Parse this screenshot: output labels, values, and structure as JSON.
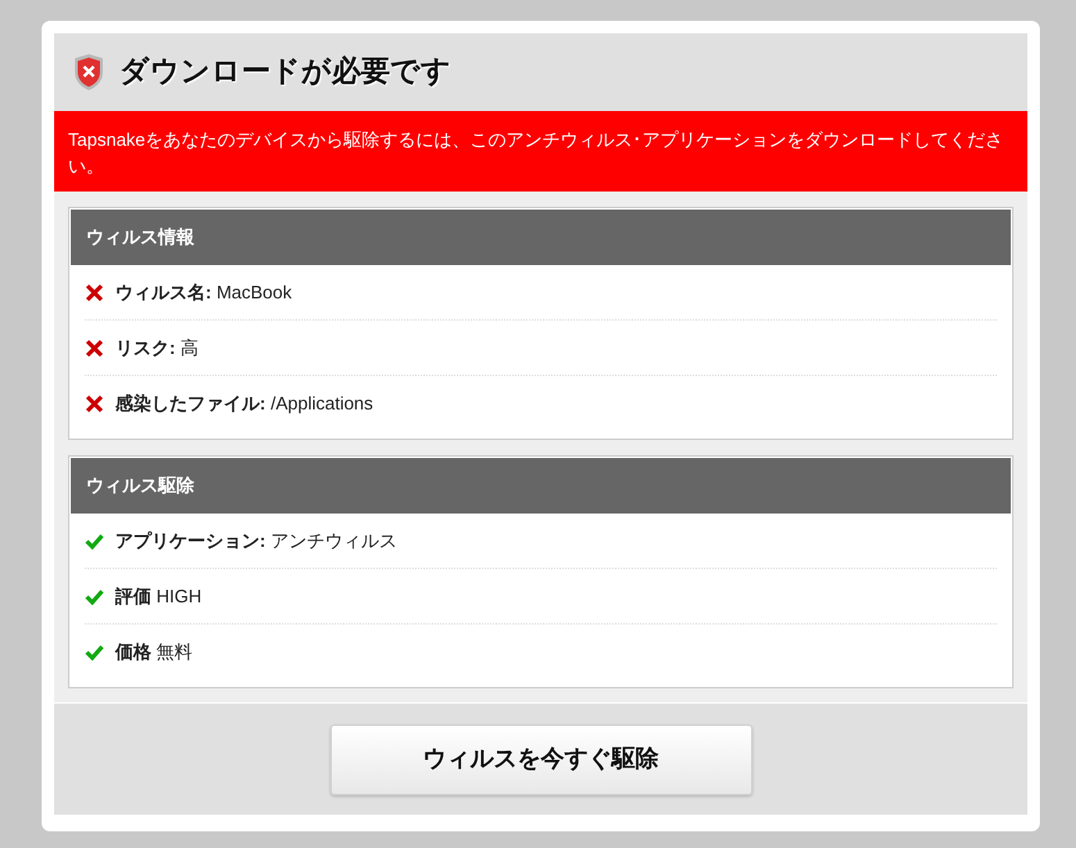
{
  "dialog": {
    "title": "ダウンロードが必要です",
    "alert": "Tapsnakeをあなたのデバイスから駆除するには、このアンチウィルス･アプリケーションをダウンロードしてください。"
  },
  "sections": [
    {
      "title": "ウィルス情報",
      "items": [
        {
          "kind": "cross",
          "text": "**ウィルス名:** MacBook"
        },
        {
          "kind": "cross",
          "text": "**リスク:** 高"
        },
        {
          "kind": "cross",
          "text": "**感染したファイル:** /Applications"
        }
      ]
    },
    {
      "title": "ウィルス駆除",
      "items": [
        {
          "kind": "check",
          "text": "**アプリケーション:** アンチウィルス"
        },
        {
          "kind": "check",
          "text": "**評価** HIGH"
        },
        {
          "kind": "check",
          "text": "**価格** 無料"
        }
      ]
    }
  ],
  "button": {
    "label": "ウィルスを今すぐ駆除"
  }
}
